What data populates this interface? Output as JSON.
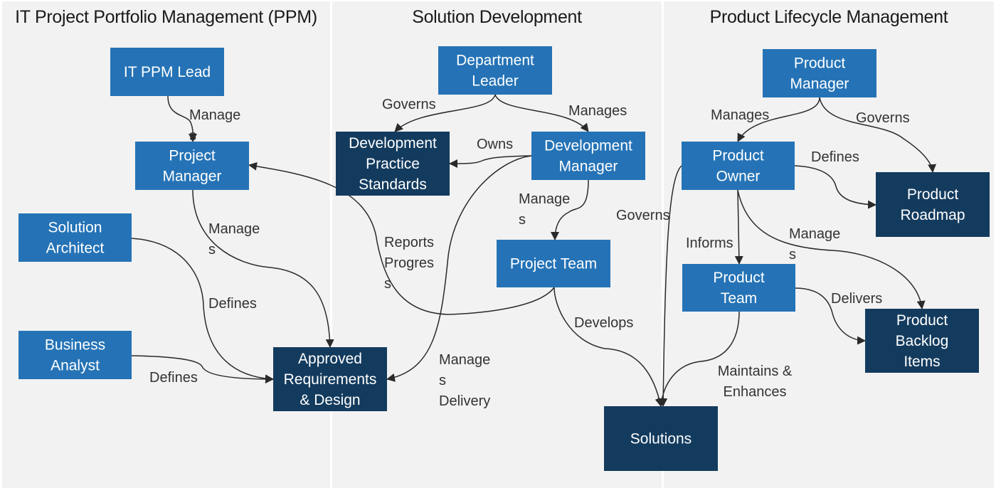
{
  "colors": {
    "background": "#ffffff",
    "panel": "#f2f2f2",
    "node_light": "#2573b6",
    "node_dark": "#133b5e",
    "edge": "#2a2a2a",
    "label": "#333333",
    "node_text": "#ffffff"
  },
  "panels": [
    {
      "id": "ppm",
      "title": "IT Project Portfolio Management (PPM)"
    },
    {
      "id": "sd",
      "title": "Solution Development"
    },
    {
      "id": "plm",
      "title": "Product Lifecycle Management"
    }
  ],
  "nodes": [
    {
      "id": "itppm",
      "panel": "ppm",
      "style": "light",
      "lines": [
        "IT PPM Lead"
      ]
    },
    {
      "id": "pm",
      "panel": "ppm",
      "style": "light",
      "lines": [
        "Project",
        "Manager"
      ]
    },
    {
      "id": "sa",
      "panel": "ppm",
      "style": "light",
      "lines": [
        "Solution",
        "Architect"
      ]
    },
    {
      "id": "ba",
      "panel": "ppm",
      "style": "light",
      "lines": [
        "Business",
        "Analyst"
      ]
    },
    {
      "id": "ard",
      "panel": "ppm",
      "style": "dark",
      "lines": [
        "Approved",
        "Requirements",
        "& Design"
      ]
    },
    {
      "id": "dl",
      "panel": "sd",
      "style": "light",
      "lines": [
        "Department",
        "Leader"
      ]
    },
    {
      "id": "dps",
      "panel": "sd",
      "style": "dark",
      "lines": [
        "Development",
        "Practice",
        "Standards"
      ]
    },
    {
      "id": "dm",
      "panel": "sd",
      "style": "light",
      "lines": [
        "Development",
        "Manager"
      ]
    },
    {
      "id": "pt",
      "panel": "sd",
      "style": "light",
      "lines": [
        "Project Team"
      ]
    },
    {
      "id": "prodmgr",
      "panel": "plm",
      "style": "light",
      "lines": [
        "Product",
        "Manager"
      ]
    },
    {
      "id": "po",
      "panel": "plm",
      "style": "light",
      "lines": [
        "Product",
        "Owner"
      ]
    },
    {
      "id": "rm",
      "panel": "plm",
      "style": "dark",
      "lines": [
        "Product",
        "Roadmap"
      ]
    },
    {
      "id": "ptm",
      "panel": "plm",
      "style": "light",
      "lines": [
        "Product",
        "Team"
      ]
    },
    {
      "id": "pbi",
      "panel": "plm",
      "style": "dark",
      "lines": [
        "Product",
        "Backlog",
        "Items"
      ]
    },
    {
      "id": "sol",
      "panel": "plm",
      "style": "dark",
      "lines": [
        "Solutions"
      ]
    }
  ],
  "edges": [
    {
      "id": "e1",
      "from": "itppm",
      "to": "pm",
      "label": [
        "Manage",
        "s"
      ]
    },
    {
      "id": "e2",
      "from": "pm",
      "to": "ard",
      "label": [
        "Manage",
        "s"
      ]
    },
    {
      "id": "e3",
      "from": "sa",
      "to": "ard",
      "label": [
        "Defines"
      ]
    },
    {
      "id": "e4",
      "from": "ba",
      "to": "ard",
      "label": [
        "Defines"
      ]
    },
    {
      "id": "e5",
      "from": "dl",
      "to": "dps",
      "label": [
        "Governs"
      ]
    },
    {
      "id": "e6",
      "from": "dl",
      "to": "dm",
      "label": [
        "Manages"
      ]
    },
    {
      "id": "e7",
      "from": "dm",
      "to": "dps",
      "label": [
        "Owns"
      ]
    },
    {
      "id": "e8",
      "from": "dm",
      "to": "pt",
      "label": [
        "Manage",
        "s"
      ]
    },
    {
      "id": "e9",
      "from": "dm",
      "to": "ard",
      "label": [
        "Manage",
        "s",
        "Delivery"
      ]
    },
    {
      "id": "e10",
      "from": "pt",
      "to": "pm",
      "label": [
        "Reports",
        "Progres",
        "s"
      ]
    },
    {
      "id": "e11",
      "from": "pt",
      "to": "sol",
      "label": [
        "Develops"
      ]
    },
    {
      "id": "e12",
      "from": "prodmgr",
      "to": "po",
      "label": [
        "Manages"
      ]
    },
    {
      "id": "e13",
      "from": "prodmgr",
      "to": "rm",
      "label": [
        "Governs"
      ]
    },
    {
      "id": "e14",
      "from": "po",
      "to": "rm",
      "label": [
        "Defines"
      ]
    },
    {
      "id": "e15",
      "from": "po",
      "to": "ptm",
      "label": [
        "Informs"
      ]
    },
    {
      "id": "e16",
      "from": "po",
      "to": "pbi",
      "label": [
        "Manage",
        "s"
      ]
    },
    {
      "id": "e17",
      "from": "po",
      "to": "sol",
      "label": [
        "Governs"
      ]
    },
    {
      "id": "e18",
      "from": "ptm",
      "to": "pbi",
      "label": [
        "Delivers"
      ]
    },
    {
      "id": "e19",
      "from": "ptm",
      "to": "sol",
      "label": [
        "Maintains &",
        "Enhances"
      ]
    }
  ]
}
